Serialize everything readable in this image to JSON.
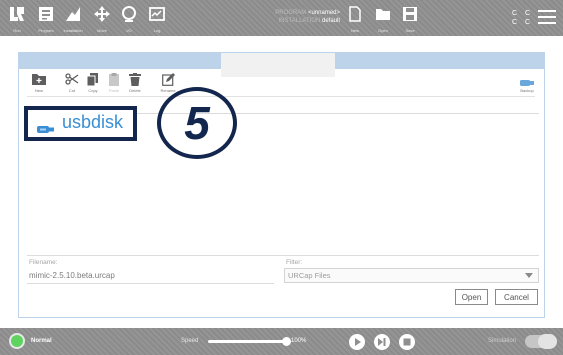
{
  "topbar": {
    "nav": [
      {
        "label": "Run",
        "icon": "ur-logo-icon"
      },
      {
        "label": "Program",
        "icon": "program-icon"
      },
      {
        "label": "Installation",
        "icon": "installation-icon"
      },
      {
        "label": "Move",
        "icon": "move-icon"
      },
      {
        "label": "I/O",
        "icon": "io-icon"
      },
      {
        "label": "Log",
        "icon": "log-icon"
      }
    ],
    "program_key": "PROGRAM",
    "program_value": "<unnamed>",
    "installation_key": "INSTALLATION",
    "installation_value": "default",
    "file_actions": [
      {
        "label": "New",
        "icon": "new-file-icon"
      },
      {
        "label": "Open",
        "icon": "open-folder-icon"
      },
      {
        "label": "Save",
        "icon": "save-icon"
      }
    ],
    "cc_top": "C C",
    "cc_bottom": "C C"
  },
  "toolbar": {
    "items": [
      {
        "label": "New",
        "icon": "new-folder-icon",
        "enabled": true
      },
      {
        "label": "Cut",
        "icon": "scissors-icon",
        "enabled": true
      },
      {
        "label": "Copy",
        "icon": "copy-icon",
        "enabled": true
      },
      {
        "label": "Paste",
        "icon": "paste-icon",
        "enabled": false
      },
      {
        "label": "Delete",
        "icon": "trash-icon",
        "enabled": true
      },
      {
        "label": "Rename",
        "icon": "rename-icon",
        "enabled": true
      }
    ],
    "backup_label": "Backup"
  },
  "files": [
    {
      "name": "usbdisk",
      "icon": "usb-drive-icon"
    }
  ],
  "step_number": "5",
  "form": {
    "filename_label": "Filename:",
    "filename_value": "mimic-2.5.10.beta.urcap",
    "filter_label": "Filter:",
    "filter_value": "URCap Files",
    "open_label": "Open",
    "cancel_label": "Cancel"
  },
  "bottombar": {
    "status": "Normal",
    "status_color": "#5fd35f",
    "speed_label": "Speed",
    "speed_value": "100%",
    "speed_fraction": 1.0,
    "simulation_label": "Simulation"
  },
  "colors": {
    "accent": "#3a8fd4",
    "highlight": "#13264d",
    "header": "#bcd3ea"
  }
}
